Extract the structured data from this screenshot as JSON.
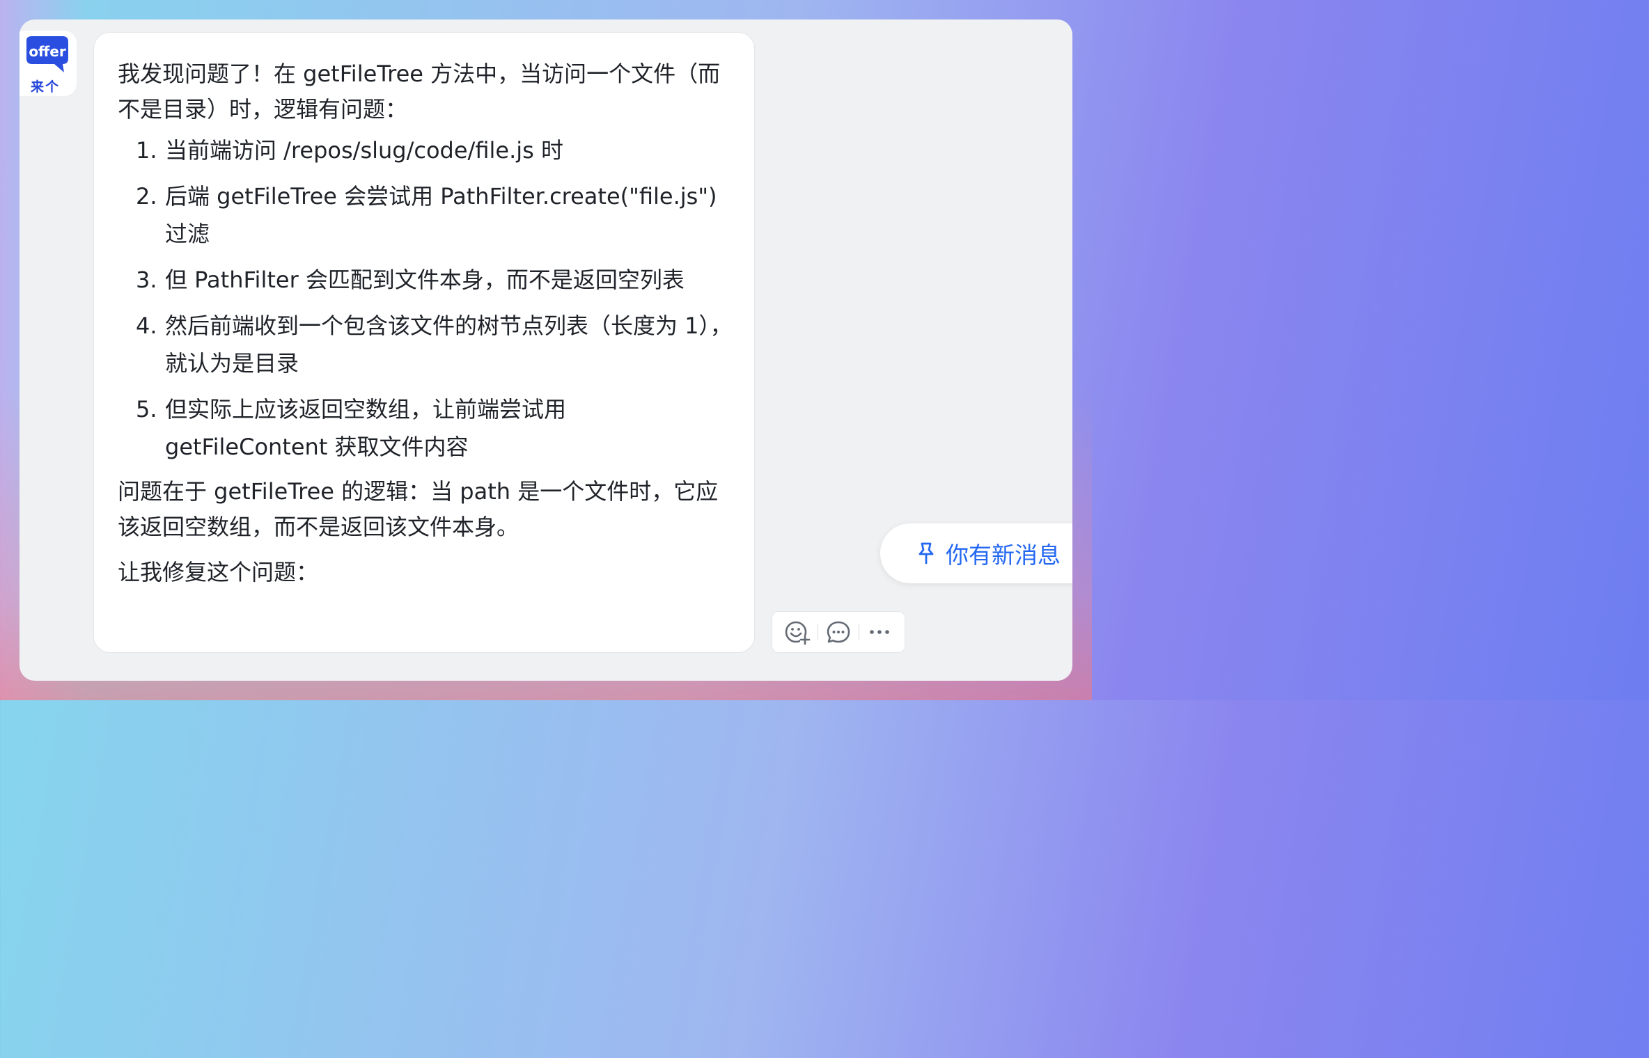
{
  "avatar": {
    "logo_text": "offer",
    "caption": "来个"
  },
  "message": {
    "intro": "我发现问题了！在 getFileTree 方法中，当访问一个文件（而不是目录）时，逻辑有问题：",
    "steps": [
      {
        "num": "1.",
        "text": "当前端访问 /repos/slug/code/file.js 时"
      },
      {
        "num": "2.",
        "text": "后端 getFileTree 会尝试用 PathFilter.create(\"file.js\") 过滤"
      },
      {
        "num": "3.",
        "text": "但 PathFilter 会匹配到文件本身，而不是返回空列表"
      },
      {
        "num": "4.",
        "text": "然后前端收到一个包含该文件的树节点列表（长度为 1），就认为是目录"
      },
      {
        "num": "5.",
        "text": "但实际上应该返回空数组，让前端尝试用 getFileContent 获取文件内容"
      }
    ],
    "conclusion": "问题在于 getFileTree 的逻辑：当 path 是一个文件时，它应该返回空数组，而不是返回该文件本身。",
    "closing": "让我修复这个问题："
  },
  "toolbar": {
    "icons": [
      "emoji-reaction-icon",
      "reply-icon",
      "more-icon"
    ]
  },
  "notification": {
    "label": "你有新消息",
    "icon": "pin-icon",
    "color": "#2468f2"
  }
}
